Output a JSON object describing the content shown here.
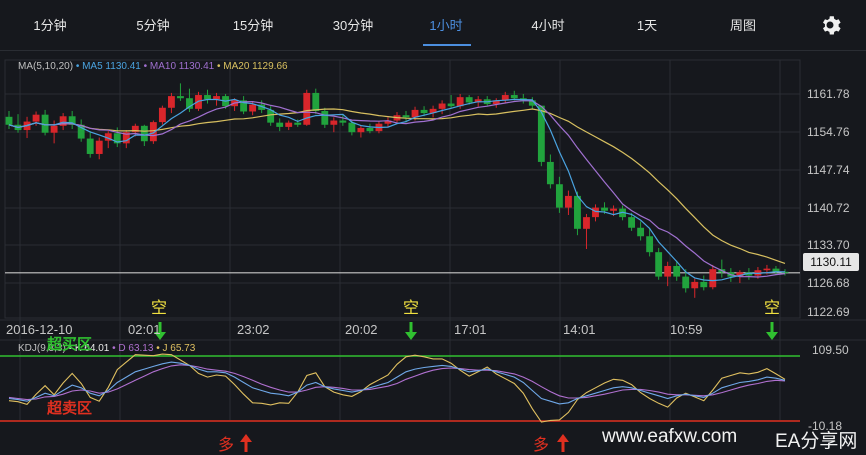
{
  "tabs": [
    {
      "label": "1分钟"
    },
    {
      "label": "5分钟"
    },
    {
      "label": "15分钟"
    },
    {
      "label": "30分钟"
    },
    {
      "label": "1小时",
      "active": true
    },
    {
      "label": "4小时"
    },
    {
      "label": "1天"
    },
    {
      "label": "周图"
    }
  ],
  "settings_icon": "gear-icon",
  "ma_legend": {
    "title": "MA(5,10,20)",
    "ma5": "• MA5 1130.41",
    "ma10": "• MA10 1130.41",
    "ma20": "• MA20 1129.66",
    "colors": {
      "ma5": "#4aa3e0",
      "ma10": "#a070d0",
      "ma20": "#d8c060"
    }
  },
  "price_axis": [
    "1161.78",
    "1154.76",
    "1147.74",
    "1140.72",
    "1133.70",
    "1126.68",
    "1122.69"
  ],
  "current_price": "1130.11",
  "time_axis": [
    "2016-12-10",
    "02:01",
    "23:02",
    "20:02",
    "17:01",
    "14:01",
    "10:59"
  ],
  "kdj_legend": {
    "title": "KDJ(9,3,3)",
    "k": "• K 64.01",
    "d": "• D 63.13",
    "j": "• J 65.73",
    "colors": {
      "k": "#ffffff",
      "d": "#b070d0",
      "j": "#e0c060"
    }
  },
  "kdj_axis": {
    "top": "109.50",
    "bottom": "-10.18"
  },
  "zones": {
    "overbought": "超买区",
    "oversold": "超卖区",
    "overbought_color": "#30c030",
    "oversold_color": "#e03020"
  },
  "signals": {
    "sell": "空",
    "buy": "多"
  },
  "watermark": {
    "site": "www.eafxw.com",
    "brand": "EA分享网"
  },
  "colors": {
    "up": "#d9262b",
    "down": "#21a33d",
    "bg": "#16181d",
    "grid": "#2a2d33"
  },
  "chart_data": {
    "type": "candlestick",
    "ohlc": [
      [
        1159.5,
        1160.6,
        1157.2,
        1158.0
      ],
      [
        1158.0,
        1160.0,
        1156.5,
        1157.0
      ],
      [
        1157.0,
        1159.5,
        1155.5,
        1158.6
      ],
      [
        1158.6,
        1160.5,
        1157.8,
        1159.9
      ],
      [
        1159.9,
        1160.8,
        1156.0,
        1156.5
      ],
      [
        1156.5,
        1158.8,
        1154.5,
        1157.8
      ],
      [
        1157.8,
        1160.2,
        1157.0,
        1159.6
      ],
      [
        1159.6,
        1160.6,
        1157.2,
        1158.0
      ],
      [
        1158.0,
        1159.0,
        1154.8,
        1155.4
      ],
      [
        1155.4,
        1156.8,
        1151.8,
        1152.5
      ],
      [
        1152.5,
        1155.6,
        1151.5,
        1155.0
      ],
      [
        1155.0,
        1156.8,
        1153.6,
        1156.4
      ],
      [
        1156.4,
        1157.5,
        1153.8,
        1154.5
      ],
      [
        1154.5,
        1157.0,
        1153.6,
        1156.6
      ],
      [
        1156.6,
        1158.2,
        1155.8,
        1157.8
      ],
      [
        1157.8,
        1158.0,
        1154.0,
        1154.9
      ],
      [
        1154.9,
        1158.8,
        1154.4,
        1158.5
      ],
      [
        1158.5,
        1161.6,
        1158.0,
        1161.2
      ],
      [
        1161.2,
        1164.0,
        1160.2,
        1163.4
      ],
      [
        1163.4,
        1165.8,
        1162.5,
        1163.0
      ],
      [
        1163.0,
        1164.8,
        1160.4,
        1161.0
      ],
      [
        1161.0,
        1164.2,
        1160.6,
        1163.6
      ],
      [
        1163.6,
        1164.6,
        1162.0,
        1162.8
      ],
      [
        1162.8,
        1164.0,
        1161.6,
        1163.4
      ],
      [
        1163.4,
        1163.8,
        1161.0,
        1161.5
      ],
      [
        1161.5,
        1163.0,
        1160.6,
        1162.6
      ],
      [
        1162.6,
        1163.4,
        1160.0,
        1160.5
      ],
      [
        1160.5,
        1162.3,
        1159.8,
        1161.8
      ],
      [
        1161.8,
        1162.6,
        1160.2,
        1160.8
      ],
      [
        1160.8,
        1161.5,
        1157.8,
        1158.4
      ],
      [
        1158.4,
        1159.2,
        1156.8,
        1157.6
      ],
      [
        1157.6,
        1158.8,
        1157.0,
        1158.4
      ],
      [
        1158.4,
        1159.0,
        1157.6,
        1158.0
      ],
      [
        1158.0,
        1164.6,
        1157.8,
        1164.0
      ],
      [
        1164.0,
        1164.8,
        1160.0,
        1160.6
      ],
      [
        1160.6,
        1161.2,
        1157.4,
        1158.0
      ],
      [
        1158.0,
        1159.4,
        1156.6,
        1158.8
      ],
      [
        1158.8,
        1159.8,
        1157.8,
        1158.4
      ],
      [
        1158.4,
        1158.8,
        1156.0,
        1156.6
      ],
      [
        1156.6,
        1157.8,
        1155.6,
        1157.4
      ],
      [
        1157.4,
        1158.2,
        1156.4,
        1156.8
      ],
      [
        1156.8,
        1158.6,
        1156.4,
        1158.2
      ],
      [
        1158.2,
        1159.4,
        1157.6,
        1158.8
      ],
      [
        1158.8,
        1160.4,
        1158.2,
        1159.8
      ],
      [
        1159.8,
        1160.6,
        1158.4,
        1159.4
      ],
      [
        1159.4,
        1161.4,
        1158.8,
        1160.8
      ],
      [
        1160.8,
        1161.5,
        1159.6,
        1160.2
      ],
      [
        1160.2,
        1161.6,
        1159.4,
        1161.0
      ],
      [
        1161.0,
        1162.6,
        1160.0,
        1162.0
      ],
      [
        1162.0,
        1163.6,
        1161.2,
        1161.5
      ],
      [
        1161.5,
        1163.8,
        1161.0,
        1163.2
      ],
      [
        1163.2,
        1163.6,
        1161.8,
        1162.2
      ],
      [
        1162.2,
        1163.4,
        1161.4,
        1162.8
      ],
      [
        1162.8,
        1163.4,
        1161.6,
        1161.9
      ],
      [
        1161.9,
        1163.0,
        1161.2,
        1162.6
      ],
      [
        1162.6,
        1164.2,
        1162.0,
        1163.6
      ],
      [
        1163.6,
        1164.4,
        1162.6,
        1163.0
      ],
      [
        1163.0,
        1163.8,
        1162.0,
        1162.6
      ],
      [
        1162.6,
        1163.2,
        1161.0,
        1161.6
      ],
      [
        1161.6,
        1156.8,
        1150.2,
        1151.0
      ],
      [
        1151.0,
        1152.4,
        1146.0,
        1146.8
      ],
      [
        1146.8,
        1148.2,
        1141.4,
        1142.4
      ],
      [
        1142.4,
        1145.6,
        1141.0,
        1144.6
      ],
      [
        1144.6,
        1145.4,
        1137.2,
        1138.4
      ],
      [
        1138.4,
        1141.2,
        1134.6,
        1140.6
      ],
      [
        1140.6,
        1143.0,
        1139.8,
        1142.4
      ],
      [
        1142.4,
        1143.4,
        1141.2,
        1141.8
      ],
      [
        1141.8,
        1142.8,
        1140.8,
        1142.2
      ],
      [
        1142.2,
        1142.8,
        1140.0,
        1140.6
      ],
      [
        1140.6,
        1141.4,
        1138.0,
        1138.6
      ],
      [
        1138.6,
        1139.8,
        1136.2,
        1137.0
      ],
      [
        1137.0,
        1138.4,
        1133.2,
        1134.0
      ],
      [
        1134.0,
        1134.8,
        1128.8,
        1129.4
      ],
      [
        1129.4,
        1132.2,
        1127.6,
        1131.4
      ],
      [
        1131.4,
        1132.4,
        1128.6,
        1129.4
      ],
      [
        1129.4,
        1130.8,
        1126.4,
        1127.2
      ],
      [
        1127.2,
        1129.0,
        1125.4,
        1128.4
      ],
      [
        1128.4,
        1129.6,
        1126.8,
        1127.4
      ],
      [
        1127.4,
        1131.6,
        1127.0,
        1130.8
      ],
      [
        1130.8,
        1132.6,
        1129.2,
        1130.2
      ],
      [
        1130.2,
        1131.0,
        1128.4,
        1129.4
      ],
      [
        1129.4,
        1130.6,
        1128.2,
        1130.2
      ],
      [
        1130.2,
        1131.0,
        1128.8,
        1129.6
      ],
      [
        1129.6,
        1131.2,
        1129.0,
        1130.6
      ],
      [
        1130.6,
        1131.6,
        1129.8,
        1130.9
      ],
      [
        1130.9,
        1131.4,
        1129.8,
        1130.3
      ],
      [
        1130.3,
        1130.8,
        1129.6,
        1130.1
      ]
    ],
    "kdj": {
      "k": [
        30,
        28,
        25,
        32,
        40,
        35,
        45,
        55,
        50,
        40,
        35,
        45,
        60,
        70,
        80,
        85,
        90,
        95,
        98,
        96,
        92,
        85,
        80,
        80,
        78,
        70,
        60,
        50,
        45,
        40,
        38,
        35,
        42,
        55,
        60,
        52,
        48,
        45,
        42,
        45,
        50,
        55,
        60,
        70,
        80,
        85,
        88,
        90,
        92,
        90,
        85,
        80,
        82,
        85,
        80,
        75,
        70,
        60,
        45,
        30,
        25,
        20,
        22,
        30,
        35,
        40,
        45,
        50,
        52,
        50,
        45,
        40,
        35,
        30,
        35,
        38,
        35,
        32,
        40,
        50,
        55,
        60,
        62,
        65,
        70,
        68,
        64
      ],
      "d": [
        32,
        30,
        28,
        29,
        33,
        34,
        38,
        44,
        46,
        44,
        40,
        42,
        48,
        56,
        64,
        72,
        80,
        86,
        91,
        93,
        92,
        89,
        85,
        83,
        81,
        77,
        71,
        64,
        57,
        51,
        46,
        42,
        42,
        46,
        51,
        52,
        51,
        49,
        46,
        46,
        47,
        50,
        53,
        58,
        66,
        72,
        78,
        83,
        86,
        87,
        86,
        84,
        83,
        83,
        82,
        79,
        76,
        70,
        62,
        52,
        43,
        35,
        31,
        31,
        32,
        35,
        38,
        42,
        46,
        47,
        47,
        45,
        42,
        38,
        37,
        37,
        36,
        35,
        37,
        41,
        46,
        51,
        55,
        58,
        62,
        64,
        63
      ],
      "j": [
        26,
        24,
        19,
        38,
        54,
        37,
        59,
        77,
        58,
        32,
        25,
        51,
        84,
        98,
        112,
        111,
        110,
        113,
        112,
        102,
        92,
        77,
        70,
        74,
        72,
        56,
        38,
        22,
        21,
        18,
        22,
        21,
        42,
        73,
        78,
        52,
        42,
        37,
        34,
        43,
        56,
        65,
        74,
        94,
        108,
        111,
        108,
        104,
        104,
        96,
        83,
        72,
        80,
        89,
        76,
        67,
        58,
        40,
        11,
        -14,
        -11,
        -10,
        4,
        28,
        41,
        50,
        59,
        66,
        64,
        56,
        41,
        30,
        21,
        14,
        31,
        40,
        33,
        26,
        46,
        68,
        73,
        78,
        76,
        79,
        86,
        76,
        66
      ]
    }
  }
}
